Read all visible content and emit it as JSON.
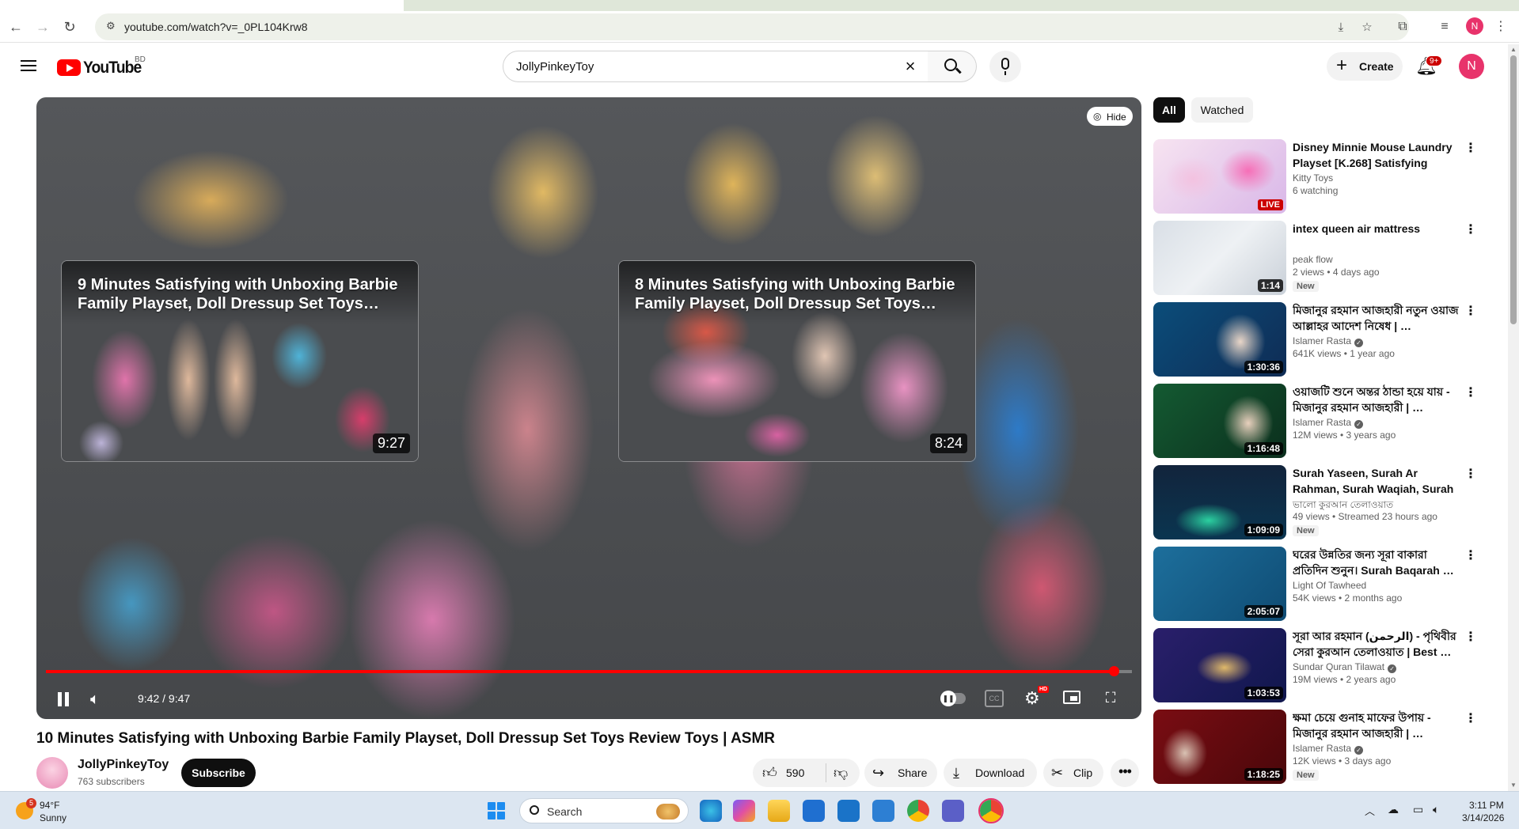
{
  "browser": {
    "url": "youtube.com/watch?v=_0PL104Krw8",
    "profile_initial": "N"
  },
  "header": {
    "logo_text": "YouTube",
    "country_code": "BD",
    "search_query": "JollyPinkeyToy",
    "create_label": "Create",
    "notification_count": "9+",
    "avatar_initial": "N"
  },
  "player": {
    "hide_label": "Hide",
    "time": "9:42 / 9:47",
    "progress_fraction": 0.983,
    "endscreen": [
      {
        "title": "9 Minutes Satisfying with Unboxing Barbie Family Playset, Doll Dressup Set Toys…",
        "duration": "9:27"
      },
      {
        "title": "8 Minutes Satisfying with Unboxing Barbie Family Playset, Doll Dressup Set Toys…",
        "duration": "8:24"
      }
    ],
    "hd_badge": "HD"
  },
  "video": {
    "title": "10 Minutes Satisfying with Unboxing Barbie Family Playset, Doll Dressup Set Toys Review Toys | ASMR",
    "channel": "JollyPinkeyToy",
    "subscribers": "763 subscribers",
    "subscribe_label": "Subscribe",
    "likes": "590",
    "share_label": "Share",
    "download_label": "Download",
    "clip_label": "Clip"
  },
  "sidebar": {
    "chips": [
      "All",
      "Watched"
    ],
    "items": [
      {
        "title": "Disney Minnie Mouse Laundry Playset [K.268] Satisfying with…",
        "channel": "Kitty Toys",
        "verified": false,
        "meta": "6 watching",
        "badge": "LIVE",
        "is_new": false
      },
      {
        "title": "intex queen air mattress",
        "channel": "peak flow",
        "verified": false,
        "meta": "2 views • 4 days ago",
        "badge": "1:14",
        "is_new": true
      },
      {
        "title": "মিজানুর রহমান আজহারী নতুন ওয়াজ আল্লাহর আদেশ নিষেধ | …",
        "channel": "Islamer Rasta",
        "verified": true,
        "meta": "641K views • 1 year ago",
        "badge": "1:30:36",
        "is_new": false
      },
      {
        "title": "ওয়াজটি শুনে অন্তর ঠান্ডা হয়ে যায় - মিজানুর রহমান আজহারী | …",
        "channel": "Islamer Rasta",
        "verified": true,
        "meta": "12M views • 3 years ago",
        "badge": "1:16:48",
        "is_new": false
      },
      {
        "title": "Surah Yaseen, Surah Ar Rahman, Surah Waqiah, Surah …",
        "channel": "ভালো কুরআন তেলাওয়াত",
        "verified": false,
        "meta": "49 views • Streamed 23 hours ago",
        "badge": "1:09:09",
        "is_new": true
      },
      {
        "title": "ঘরের উন্নতির জন্য সূরা বাকারা প্রতিদিন শুনুন। Surah Baqarah …",
        "channel": "Light Of Tawheed",
        "verified": false,
        "meta": "54K views • 2 months ago",
        "badge": "2:05:07",
        "is_new": false
      },
      {
        "title": "সূরা আর রহমান (الرحمن) - পৃথিবীর সেরা কুরআন তেলাওয়াত | Best …",
        "channel": "Sundar Quran Tilawat",
        "verified": true,
        "meta": "19M views • 2 years ago",
        "badge": "1:03:53",
        "is_new": false
      },
      {
        "title": "ক্ষমা চেয়ে গুনাহ মাফের উপায় - মিজানুর রহমান আজহারী | …",
        "channel": "Islamer Rasta",
        "verified": true,
        "meta": "12K views • 3 days ago",
        "badge": "1:18:25",
        "is_new": true
      }
    ],
    "new_label": "New"
  },
  "taskbar": {
    "weather_badge": "5",
    "temperature": "94°F",
    "condition": "Sunny",
    "search_label": "Search",
    "time": "3:11 PM",
    "date": "3/14/2026"
  },
  "colors": {
    "brand_red": "#ff0000",
    "progress_red": "#ff0000",
    "avatar_pink": "#e8336b"
  }
}
